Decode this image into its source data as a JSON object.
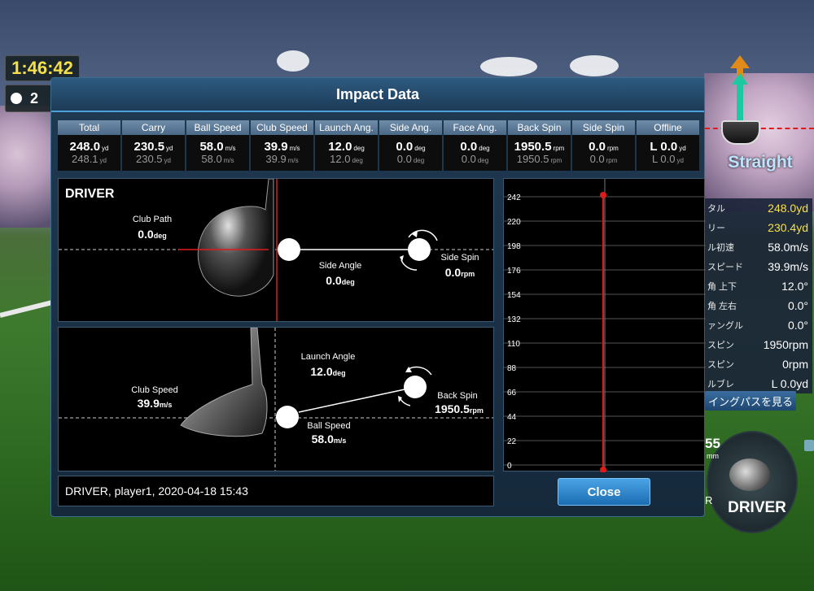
{
  "hud": {
    "timer": "1:46:42",
    "ball_count": "2",
    "shot_direction": "Straight",
    "rows": [
      {
        "label": "タル",
        "value": "248.0yd",
        "highlight": true
      },
      {
        "label": "リー",
        "value": "230.4yd",
        "highlight": true
      },
      {
        "label": "ル初速",
        "value": "58.0m/s",
        "highlight": false
      },
      {
        "label": "スピード",
        "value": "39.9m/s",
        "highlight": false
      },
      {
        "label": "角 上下",
        "value": "12.0°",
        "highlight": false
      },
      {
        "label": "角 左右",
        "value": "0.0°",
        "highlight": false
      },
      {
        "label": "ァングル",
        "value": "0.0°",
        "highlight": false
      },
      {
        "label": "スピン",
        "value": "1950rpm",
        "highlight": false
      },
      {
        "label": "スピン",
        "value": "0rpm",
        "highlight": false
      },
      {
        "label": "ルブレ",
        "value": "L 0.0yd",
        "highlight": false
      }
    ],
    "swing_path_button": "イングパスを見る",
    "club_number": "55",
    "club_unit": "mm",
    "club_letter": "R",
    "club_name": "DRIVER"
  },
  "panel": {
    "title": "Impact Data",
    "stats": [
      {
        "label": "Total",
        "value": "248.0",
        "unit": "yd",
        "prev": "248.1",
        "prev_unit": "yd"
      },
      {
        "label": "Carry",
        "value": "230.5",
        "unit": "yd",
        "prev": "230.5",
        "prev_unit": "yd"
      },
      {
        "label": "Ball Speed",
        "value": "58.0",
        "unit": "m/s",
        "prev": "58.0",
        "prev_unit": "m/s"
      },
      {
        "label": "Club Speed",
        "value": "39.9",
        "unit": "m/s",
        "prev": "39.9",
        "prev_unit": "m/s"
      },
      {
        "label": "Launch Ang.",
        "value": "12.0",
        "unit": "deg",
        "prev": "12.0",
        "prev_unit": "deg"
      },
      {
        "label": "Side Ang.",
        "value": "0.0",
        "unit": "deg",
        "prev": "0.0",
        "prev_unit": "deg"
      },
      {
        "label": "Face Ang.",
        "value": "0.0",
        "unit": "deg",
        "prev": "0.0",
        "prev_unit": "deg"
      },
      {
        "label": "Back Spin",
        "value": "1950.5",
        "unit": "rpm",
        "prev": "1950.5",
        "prev_unit": "rpm"
      },
      {
        "label": "Side Spin",
        "value": "0.0",
        "unit": "rpm",
        "prev": "0.0",
        "prev_unit": "rpm"
      },
      {
        "label": "Offline",
        "value": "L 0.0",
        "unit": "yd",
        "prev": "L 0.0",
        "prev_unit": "yd"
      }
    ],
    "top_view": {
      "club": "DRIVER",
      "club_path_label": "Club Path",
      "club_path_value": "0.0",
      "club_path_unit": "deg",
      "side_angle_label": "Side Angle",
      "side_angle_value": "0.0",
      "side_angle_unit": "deg",
      "side_spin_label": "Side Spin",
      "side_spin_value": "0.0",
      "side_spin_unit": "rpm"
    },
    "side_view": {
      "launch_angle_label": "Launch Angle",
      "launch_angle_value": "12.0",
      "launch_angle_unit": "deg",
      "club_speed_label": "Club Speed",
      "club_speed_value": "39.9",
      "club_speed_unit": "m/s",
      "back_spin_label": "Back Spin",
      "back_spin_value": "1950.5",
      "back_spin_unit": "rpm",
      "ball_speed_label": "Ball Speed",
      "ball_speed_value": "58.0",
      "ball_speed_unit": "m/s"
    },
    "info": "DRIVER, player1, 2020-04-18 15:43",
    "graph_ticks": [
      "242",
      "220",
      "198",
      "176",
      "154",
      "132",
      "110",
      "88",
      "66",
      "44",
      "22",
      "0"
    ],
    "close_label": "Close"
  },
  "colors": {
    "accent_yellow": "#f5e04a",
    "trajectory_red": "#e01a1a",
    "button_blue": "#1c6db3"
  }
}
